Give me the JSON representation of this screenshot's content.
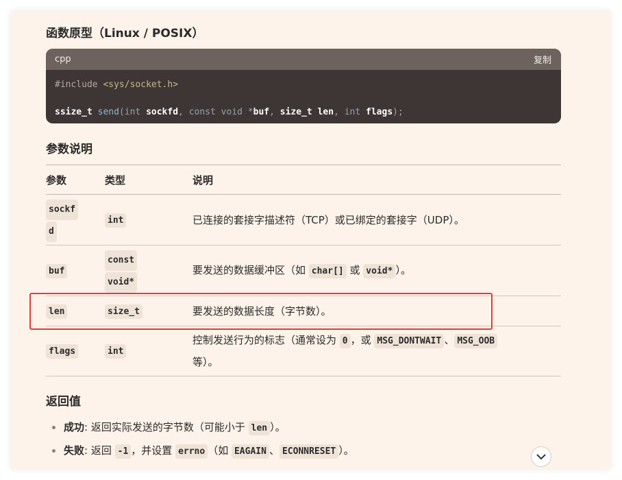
{
  "section_prototype": {
    "title": "函数原型（Linux / POSIX）"
  },
  "code": {
    "lang": "cpp",
    "copy_label": "复制",
    "line1": {
      "directive": "#include",
      "header": "<sys/socket.h>"
    },
    "line2": {
      "ret": "ssize_t",
      "fn": "send",
      "p1_type": "int",
      "p1_name": "sockfd",
      "p2_type": "const void",
      "p2_star": "*",
      "p2_name": "buf",
      "p3_type": "size_t",
      "p3_name": "len",
      "p4_type": "int",
      "p4_name": "flags",
      "end": ");"
    }
  },
  "section_params": {
    "title": "参数说明"
  },
  "table": {
    "headers": [
      "参数",
      "类型",
      "说明"
    ],
    "rows": [
      {
        "param_l1": "sockf",
        "param_l2": "d",
        "type": "int",
        "desc": "已连接的套接字描述符（TCP）或已绑定的套接字（UDP）。"
      },
      {
        "param": "buf",
        "type_l1": "const",
        "type_l2": "void*",
        "desc_pre": "要发送的数据缓冲区（如 ",
        "desc_code1": "char[]",
        "desc_mid": " 或 ",
        "desc_code2": "void*",
        "desc_post": "）。"
      },
      {
        "param": "len",
        "type": "size_t",
        "desc": "要发送的数据长度（字节数）。"
      },
      {
        "param": "flags",
        "type": "int",
        "desc_pre": "控制发送行为的标志（通常设为 ",
        "desc_code1": "0",
        "desc_mid1": "，或 ",
        "desc_code2": "MSG_DONTWAIT",
        "desc_mid2": "、",
        "desc_code3": "MSG_OOB",
        "desc_post": "等）。"
      }
    ]
  },
  "section_return": {
    "title": "返回值"
  },
  "returns": [
    {
      "label": "成功",
      "sep": ": ",
      "text_pre": "返回实际发送的字节数（可能小于 ",
      "code": "len",
      "text_post": "）。"
    },
    {
      "label": "失败",
      "sep": ": ",
      "text_pre": "返回 ",
      "code1": "-1",
      "text_mid1": "，并设置 ",
      "code2": "errno",
      "text_mid2": "（如 ",
      "code3": "EAGAIN",
      "text_mid3": "、",
      "code4": "ECONNRESET",
      "text_post": "）。"
    }
  ],
  "icons": {
    "scroll_down": "chevron-down-icon"
  },
  "colors": {
    "highlight_border": "#e23b3b",
    "page_bg": "#fdf3ea",
    "code_bg": "#3e3635"
  }
}
